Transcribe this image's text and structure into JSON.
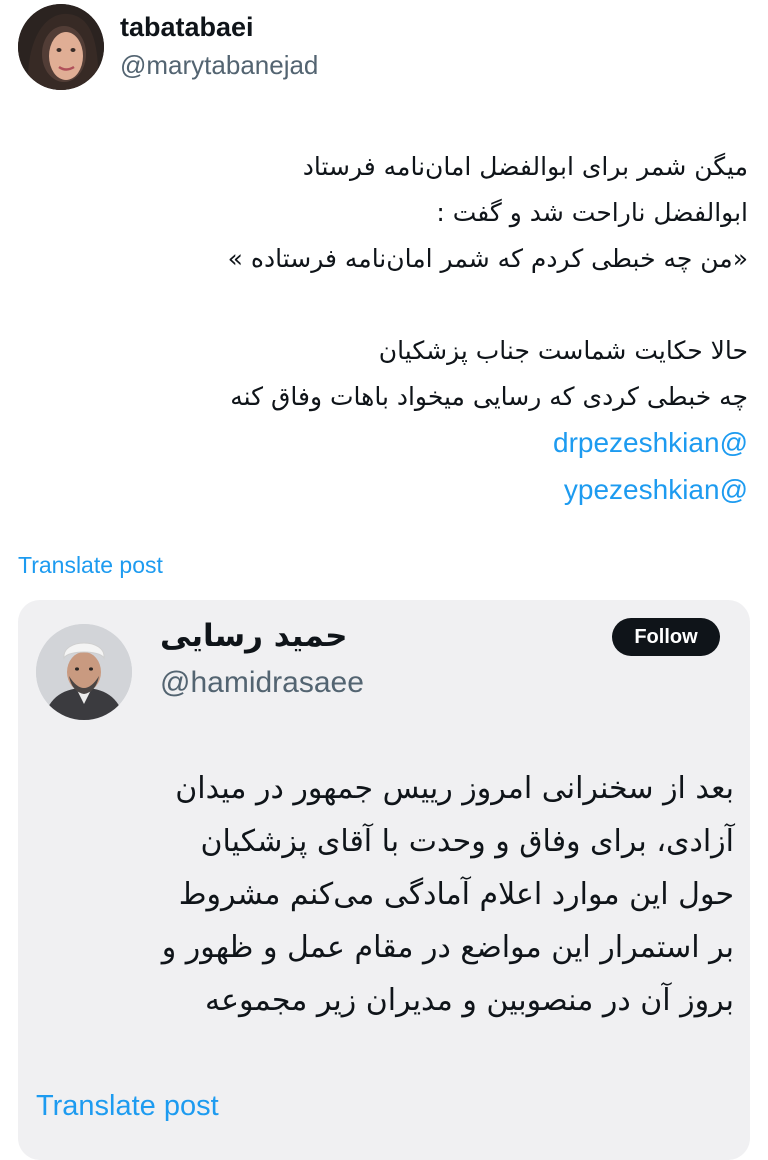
{
  "tweet": {
    "author_name": "tabatabaei",
    "author_handle": "@marytabanejad",
    "lines": [
      "میگن شمر برای ابوالفضل امان‌نامه فرستاد",
      "ابوالفضل ناراحت شد و گفت :",
      "«من چه خبطی کردم که شمر امان‌نامه فرستاده »",
      "حالا حکایت شماست جناب پزشکیان",
      "چه خبطی کردی که رسایی میخواد باهات وفاق کنه"
    ],
    "mentions": [
      "@drpezeshkian",
      "@ypezeshkian"
    ],
    "translate_label": "Translate post"
  },
  "quoted": {
    "author_name": "حمید رسایی",
    "author_handle": "@hamidrasaee",
    "follow_label": "Follow",
    "lines": [
      "بعد از سخنرانی امروز رییس جمهور در میدان",
      "آزادی، برای وفاق و وحدت با آقای پزشکیان",
      "حول این موارد اعلام آمادگی می‌کنم مشروط",
      "بر استمرار این مواضع در مقام عمل و ظهور و",
      "بروز آن در منصوبین و مدیران زیر مجموعه"
    ],
    "translate_label": "Translate post"
  },
  "colors": {
    "link": "#1d9bf0",
    "card_bg": "#f0f0f2",
    "follow_bg": "#0f1419"
  }
}
